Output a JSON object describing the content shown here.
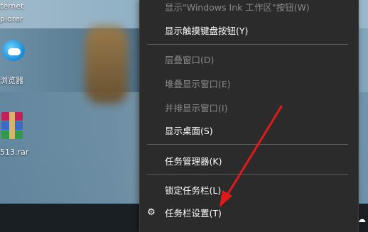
{
  "desktop": {
    "icons": [
      {
        "label_line1": "ternet",
        "label_line2": "plorer"
      },
      {
        "label": "浏览器"
      },
      {
        "label": "513.rar"
      }
    ]
  },
  "context_menu": {
    "items": [
      {
        "label": "显示\"Windows Ink 工作区\"按钮(W)",
        "enabled": false
      },
      {
        "label": "显示触摸键盘按钮(Y)",
        "enabled": true
      },
      {
        "label": "层叠窗口(D)",
        "enabled": false
      },
      {
        "label": "堆叠显示窗口(E)",
        "enabled": false
      },
      {
        "label": "并排显示窗口(I)",
        "enabled": false
      },
      {
        "label": "显示桌面(S)",
        "enabled": true
      },
      {
        "label": "任务管理器(K)",
        "enabled": true
      },
      {
        "label": "锁定任务栏(L)",
        "enabled": true
      },
      {
        "label": "任务栏设置(T)",
        "enabled": true,
        "icon": "gear-icon"
      }
    ]
  },
  "annotation": {
    "arrow_color": "#e0191b"
  },
  "taskbar": {
    "tray_icon": "cloud-icon"
  }
}
